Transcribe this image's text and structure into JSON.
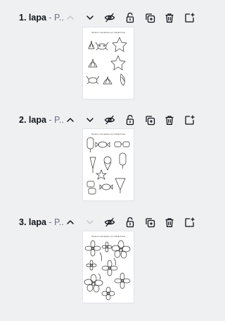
{
  "pages": [
    {
      "number": "1.",
      "name": "lapa",
      "subtitle": " - P..",
      "caption": "Stickers coloriables par ClarilleCreat",
      "theme": "sea"
    },
    {
      "number": "2.",
      "name": "lapa",
      "subtitle": " - P..",
      "caption": "Stickers coloriables par ClarilleCreat",
      "theme": "summer"
    },
    {
      "number": "3.",
      "name": "lapa",
      "subtitle": " - P..",
      "caption": "Stickers coloriables par ClarilleCreat",
      "theme": "flowers"
    }
  ],
  "controls": {
    "move_up": "chevron-up-icon",
    "move_down": "chevron-down-icon",
    "hide": "eye-slash-icon",
    "lock": "unlock-icon",
    "duplicate": "duplicate-icon",
    "delete": "trash-icon",
    "add": "add-page-icon"
  },
  "colors": {
    "background": "#eef0f2",
    "icon": "#0e1318",
    "icon_disabled": "#c4c7cc"
  }
}
